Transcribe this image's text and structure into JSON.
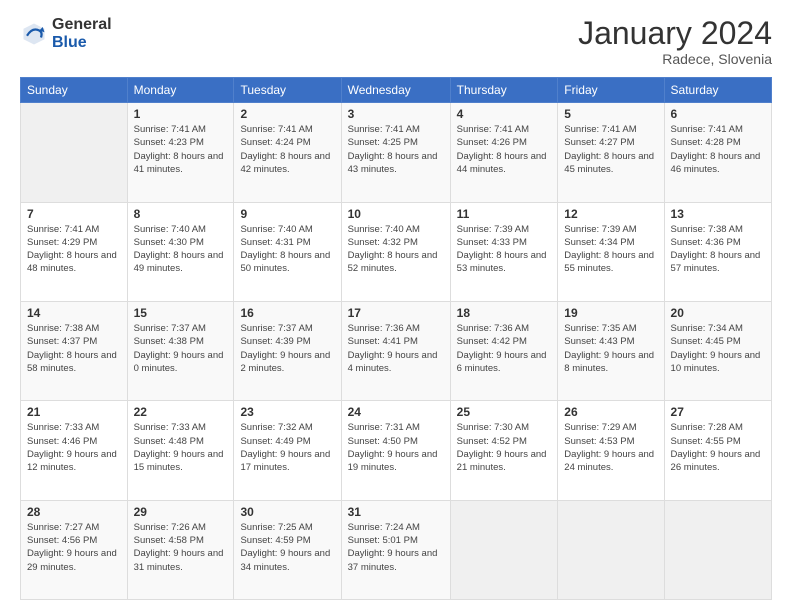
{
  "logo": {
    "general": "General",
    "blue": "Blue"
  },
  "header": {
    "month": "January 2024",
    "location": "Radece, Slovenia"
  },
  "weekdays": [
    "Sunday",
    "Monday",
    "Tuesday",
    "Wednesday",
    "Thursday",
    "Friday",
    "Saturday"
  ],
  "weeks": [
    [
      {
        "day": "",
        "sunrise": "",
        "sunset": "",
        "daylight": ""
      },
      {
        "day": "1",
        "sunrise": "Sunrise: 7:41 AM",
        "sunset": "Sunset: 4:23 PM",
        "daylight": "Daylight: 8 hours and 41 minutes."
      },
      {
        "day": "2",
        "sunrise": "Sunrise: 7:41 AM",
        "sunset": "Sunset: 4:24 PM",
        "daylight": "Daylight: 8 hours and 42 minutes."
      },
      {
        "day": "3",
        "sunrise": "Sunrise: 7:41 AM",
        "sunset": "Sunset: 4:25 PM",
        "daylight": "Daylight: 8 hours and 43 minutes."
      },
      {
        "day": "4",
        "sunrise": "Sunrise: 7:41 AM",
        "sunset": "Sunset: 4:26 PM",
        "daylight": "Daylight: 8 hours and 44 minutes."
      },
      {
        "day": "5",
        "sunrise": "Sunrise: 7:41 AM",
        "sunset": "Sunset: 4:27 PM",
        "daylight": "Daylight: 8 hours and 45 minutes."
      },
      {
        "day": "6",
        "sunrise": "Sunrise: 7:41 AM",
        "sunset": "Sunset: 4:28 PM",
        "daylight": "Daylight: 8 hours and 46 minutes."
      }
    ],
    [
      {
        "day": "7",
        "sunrise": "Sunrise: 7:41 AM",
        "sunset": "Sunset: 4:29 PM",
        "daylight": "Daylight: 8 hours and 48 minutes."
      },
      {
        "day": "8",
        "sunrise": "Sunrise: 7:40 AM",
        "sunset": "Sunset: 4:30 PM",
        "daylight": "Daylight: 8 hours and 49 minutes."
      },
      {
        "day": "9",
        "sunrise": "Sunrise: 7:40 AM",
        "sunset": "Sunset: 4:31 PM",
        "daylight": "Daylight: 8 hours and 50 minutes."
      },
      {
        "day": "10",
        "sunrise": "Sunrise: 7:40 AM",
        "sunset": "Sunset: 4:32 PM",
        "daylight": "Daylight: 8 hours and 52 minutes."
      },
      {
        "day": "11",
        "sunrise": "Sunrise: 7:39 AM",
        "sunset": "Sunset: 4:33 PM",
        "daylight": "Daylight: 8 hours and 53 minutes."
      },
      {
        "day": "12",
        "sunrise": "Sunrise: 7:39 AM",
        "sunset": "Sunset: 4:34 PM",
        "daylight": "Daylight: 8 hours and 55 minutes."
      },
      {
        "day": "13",
        "sunrise": "Sunrise: 7:38 AM",
        "sunset": "Sunset: 4:36 PM",
        "daylight": "Daylight: 8 hours and 57 minutes."
      }
    ],
    [
      {
        "day": "14",
        "sunrise": "Sunrise: 7:38 AM",
        "sunset": "Sunset: 4:37 PM",
        "daylight": "Daylight: 8 hours and 58 minutes."
      },
      {
        "day": "15",
        "sunrise": "Sunrise: 7:37 AM",
        "sunset": "Sunset: 4:38 PM",
        "daylight": "Daylight: 9 hours and 0 minutes."
      },
      {
        "day": "16",
        "sunrise": "Sunrise: 7:37 AM",
        "sunset": "Sunset: 4:39 PM",
        "daylight": "Daylight: 9 hours and 2 minutes."
      },
      {
        "day": "17",
        "sunrise": "Sunrise: 7:36 AM",
        "sunset": "Sunset: 4:41 PM",
        "daylight": "Daylight: 9 hours and 4 minutes."
      },
      {
        "day": "18",
        "sunrise": "Sunrise: 7:36 AM",
        "sunset": "Sunset: 4:42 PM",
        "daylight": "Daylight: 9 hours and 6 minutes."
      },
      {
        "day": "19",
        "sunrise": "Sunrise: 7:35 AM",
        "sunset": "Sunset: 4:43 PM",
        "daylight": "Daylight: 9 hours and 8 minutes."
      },
      {
        "day": "20",
        "sunrise": "Sunrise: 7:34 AM",
        "sunset": "Sunset: 4:45 PM",
        "daylight": "Daylight: 9 hours and 10 minutes."
      }
    ],
    [
      {
        "day": "21",
        "sunrise": "Sunrise: 7:33 AM",
        "sunset": "Sunset: 4:46 PM",
        "daylight": "Daylight: 9 hours and 12 minutes."
      },
      {
        "day": "22",
        "sunrise": "Sunrise: 7:33 AM",
        "sunset": "Sunset: 4:48 PM",
        "daylight": "Daylight: 9 hours and 15 minutes."
      },
      {
        "day": "23",
        "sunrise": "Sunrise: 7:32 AM",
        "sunset": "Sunset: 4:49 PM",
        "daylight": "Daylight: 9 hours and 17 minutes."
      },
      {
        "day": "24",
        "sunrise": "Sunrise: 7:31 AM",
        "sunset": "Sunset: 4:50 PM",
        "daylight": "Daylight: 9 hours and 19 minutes."
      },
      {
        "day": "25",
        "sunrise": "Sunrise: 7:30 AM",
        "sunset": "Sunset: 4:52 PM",
        "daylight": "Daylight: 9 hours and 21 minutes."
      },
      {
        "day": "26",
        "sunrise": "Sunrise: 7:29 AM",
        "sunset": "Sunset: 4:53 PM",
        "daylight": "Daylight: 9 hours and 24 minutes."
      },
      {
        "day": "27",
        "sunrise": "Sunrise: 7:28 AM",
        "sunset": "Sunset: 4:55 PM",
        "daylight": "Daylight: 9 hours and 26 minutes."
      }
    ],
    [
      {
        "day": "28",
        "sunrise": "Sunrise: 7:27 AM",
        "sunset": "Sunset: 4:56 PM",
        "daylight": "Daylight: 9 hours and 29 minutes."
      },
      {
        "day": "29",
        "sunrise": "Sunrise: 7:26 AM",
        "sunset": "Sunset: 4:58 PM",
        "daylight": "Daylight: 9 hours and 31 minutes."
      },
      {
        "day": "30",
        "sunrise": "Sunrise: 7:25 AM",
        "sunset": "Sunset: 4:59 PM",
        "daylight": "Daylight: 9 hours and 34 minutes."
      },
      {
        "day": "31",
        "sunrise": "Sunrise: 7:24 AM",
        "sunset": "Sunset: 5:01 PM",
        "daylight": "Daylight: 9 hours and 37 minutes."
      },
      {
        "day": "",
        "sunrise": "",
        "sunset": "",
        "daylight": ""
      },
      {
        "day": "",
        "sunrise": "",
        "sunset": "",
        "daylight": ""
      },
      {
        "day": "",
        "sunrise": "",
        "sunset": "",
        "daylight": ""
      }
    ]
  ]
}
